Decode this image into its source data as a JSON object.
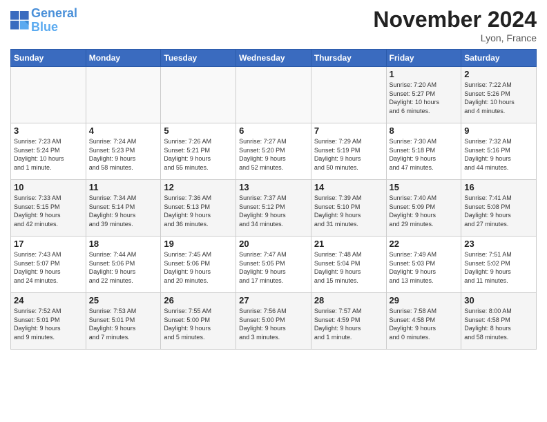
{
  "header": {
    "logo_line1": "General",
    "logo_line2": "Blue",
    "month_title": "November 2024",
    "location": "Lyon, France"
  },
  "days_of_week": [
    "Sunday",
    "Monday",
    "Tuesday",
    "Wednesday",
    "Thursday",
    "Friday",
    "Saturday"
  ],
  "weeks": [
    [
      {
        "day": "",
        "info": ""
      },
      {
        "day": "",
        "info": ""
      },
      {
        "day": "",
        "info": ""
      },
      {
        "day": "",
        "info": ""
      },
      {
        "day": "",
        "info": ""
      },
      {
        "day": "1",
        "info": "Sunrise: 7:20 AM\nSunset: 5:27 PM\nDaylight: 10 hours\nand 6 minutes."
      },
      {
        "day": "2",
        "info": "Sunrise: 7:22 AM\nSunset: 5:26 PM\nDaylight: 10 hours\nand 4 minutes."
      }
    ],
    [
      {
        "day": "3",
        "info": "Sunrise: 7:23 AM\nSunset: 5:24 PM\nDaylight: 10 hours\nand 1 minute."
      },
      {
        "day": "4",
        "info": "Sunrise: 7:24 AM\nSunset: 5:23 PM\nDaylight: 9 hours\nand 58 minutes."
      },
      {
        "day": "5",
        "info": "Sunrise: 7:26 AM\nSunset: 5:21 PM\nDaylight: 9 hours\nand 55 minutes."
      },
      {
        "day": "6",
        "info": "Sunrise: 7:27 AM\nSunset: 5:20 PM\nDaylight: 9 hours\nand 52 minutes."
      },
      {
        "day": "7",
        "info": "Sunrise: 7:29 AM\nSunset: 5:19 PM\nDaylight: 9 hours\nand 50 minutes."
      },
      {
        "day": "8",
        "info": "Sunrise: 7:30 AM\nSunset: 5:18 PM\nDaylight: 9 hours\nand 47 minutes."
      },
      {
        "day": "9",
        "info": "Sunrise: 7:32 AM\nSunset: 5:16 PM\nDaylight: 9 hours\nand 44 minutes."
      }
    ],
    [
      {
        "day": "10",
        "info": "Sunrise: 7:33 AM\nSunset: 5:15 PM\nDaylight: 9 hours\nand 42 minutes."
      },
      {
        "day": "11",
        "info": "Sunrise: 7:34 AM\nSunset: 5:14 PM\nDaylight: 9 hours\nand 39 minutes."
      },
      {
        "day": "12",
        "info": "Sunrise: 7:36 AM\nSunset: 5:13 PM\nDaylight: 9 hours\nand 36 minutes."
      },
      {
        "day": "13",
        "info": "Sunrise: 7:37 AM\nSunset: 5:12 PM\nDaylight: 9 hours\nand 34 minutes."
      },
      {
        "day": "14",
        "info": "Sunrise: 7:39 AM\nSunset: 5:10 PM\nDaylight: 9 hours\nand 31 minutes."
      },
      {
        "day": "15",
        "info": "Sunrise: 7:40 AM\nSunset: 5:09 PM\nDaylight: 9 hours\nand 29 minutes."
      },
      {
        "day": "16",
        "info": "Sunrise: 7:41 AM\nSunset: 5:08 PM\nDaylight: 9 hours\nand 27 minutes."
      }
    ],
    [
      {
        "day": "17",
        "info": "Sunrise: 7:43 AM\nSunset: 5:07 PM\nDaylight: 9 hours\nand 24 minutes."
      },
      {
        "day": "18",
        "info": "Sunrise: 7:44 AM\nSunset: 5:06 PM\nDaylight: 9 hours\nand 22 minutes."
      },
      {
        "day": "19",
        "info": "Sunrise: 7:45 AM\nSunset: 5:06 PM\nDaylight: 9 hours\nand 20 minutes."
      },
      {
        "day": "20",
        "info": "Sunrise: 7:47 AM\nSunset: 5:05 PM\nDaylight: 9 hours\nand 17 minutes."
      },
      {
        "day": "21",
        "info": "Sunrise: 7:48 AM\nSunset: 5:04 PM\nDaylight: 9 hours\nand 15 minutes."
      },
      {
        "day": "22",
        "info": "Sunrise: 7:49 AM\nSunset: 5:03 PM\nDaylight: 9 hours\nand 13 minutes."
      },
      {
        "day": "23",
        "info": "Sunrise: 7:51 AM\nSunset: 5:02 PM\nDaylight: 9 hours\nand 11 minutes."
      }
    ],
    [
      {
        "day": "24",
        "info": "Sunrise: 7:52 AM\nSunset: 5:01 PM\nDaylight: 9 hours\nand 9 minutes."
      },
      {
        "day": "25",
        "info": "Sunrise: 7:53 AM\nSunset: 5:01 PM\nDaylight: 9 hours\nand 7 minutes."
      },
      {
        "day": "26",
        "info": "Sunrise: 7:55 AM\nSunset: 5:00 PM\nDaylight: 9 hours\nand 5 minutes."
      },
      {
        "day": "27",
        "info": "Sunrise: 7:56 AM\nSunset: 5:00 PM\nDaylight: 9 hours\nand 3 minutes."
      },
      {
        "day": "28",
        "info": "Sunrise: 7:57 AM\nSunset: 4:59 PM\nDaylight: 9 hours\nand 1 minute."
      },
      {
        "day": "29",
        "info": "Sunrise: 7:58 AM\nSunset: 4:58 PM\nDaylight: 9 hours\nand 0 minutes."
      },
      {
        "day": "30",
        "info": "Sunrise: 8:00 AM\nSunset: 4:58 PM\nDaylight: 8 hours\nand 58 minutes."
      }
    ]
  ]
}
